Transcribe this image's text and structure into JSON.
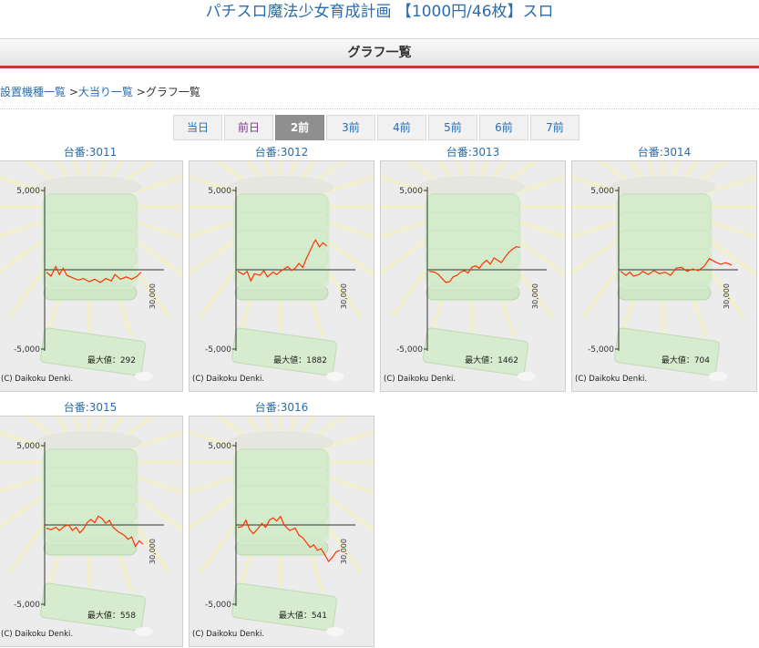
{
  "page": {
    "title": "パチスロ魔法少女育成計画 【1000円/46枚】スロ",
    "section_title": "グラフ一覧"
  },
  "breadcrumb": {
    "items": [
      "設置機種一覧",
      "大当り一覧"
    ],
    "current": "グラフ一覧",
    "separator": ">"
  },
  "day_tabs": [
    {
      "label": "当日",
      "active": false,
      "visited": false
    },
    {
      "label": "前日",
      "active": false,
      "visited": true
    },
    {
      "label": "2前",
      "active": true,
      "visited": false
    },
    {
      "label": "3前",
      "active": false,
      "visited": false
    },
    {
      "label": "4前",
      "active": false,
      "visited": false
    },
    {
      "label": "5前",
      "active": false,
      "visited": false
    },
    {
      "label": "6前",
      "active": false,
      "visited": false
    },
    {
      "label": "7前",
      "active": false,
      "visited": false
    }
  ],
  "graph_common": {
    "y_top_label": "5,000",
    "y_bottom_label": "-5,000",
    "x_max_label": "30,000",
    "max_label_prefix": "最大値：",
    "copyright": "(C) Daikoku Denki.",
    "y_range": [
      -5000,
      5000
    ],
    "x_range": [
      0,
      30000
    ],
    "line_color": "#ff3300",
    "axis_color": "#333333"
  },
  "machines": [
    {
      "label": "台番:3011",
      "max_value": "292",
      "points": [
        [
          0,
          -150
        ],
        [
          1200,
          -400
        ],
        [
          2500,
          200
        ],
        [
          3500,
          -300
        ],
        [
          4500,
          100
        ],
        [
          5500,
          -350
        ],
        [
          7000,
          -500
        ],
        [
          8500,
          -650
        ],
        [
          10000,
          -550
        ],
        [
          11500,
          -750
        ],
        [
          13000,
          -600
        ],
        [
          14500,
          -800
        ],
        [
          16000,
          -550
        ],
        [
          17500,
          -700
        ],
        [
          18500,
          -300
        ],
        [
          20000,
          -600
        ],
        [
          21500,
          -450
        ],
        [
          23000,
          -600
        ],
        [
          24500,
          -400
        ],
        [
          25500,
          -150
        ]
      ]
    },
    {
      "label": "台番:3012",
      "max_value": "1882",
      "points": [
        [
          0,
          -100
        ],
        [
          1500,
          -300
        ],
        [
          2500,
          -100
        ],
        [
          3500,
          -700
        ],
        [
          4500,
          -250
        ],
        [
          6000,
          -350
        ],
        [
          7000,
          -50
        ],
        [
          8000,
          -450
        ],
        [
          9500,
          -150
        ],
        [
          10500,
          -300
        ],
        [
          11500,
          -100
        ],
        [
          12500,
          50
        ],
        [
          13500,
          200
        ],
        [
          14500,
          -50
        ],
        [
          15500,
          100
        ],
        [
          16500,
          400
        ],
        [
          17500,
          150
        ],
        [
          18500,
          700
        ],
        [
          19500,
          1200
        ],
        [
          20500,
          1700
        ],
        [
          21000,
          1882
        ],
        [
          22000,
          1450
        ],
        [
          23000,
          1700
        ],
        [
          24000,
          1500
        ]
      ]
    },
    {
      "label": "台番:3013",
      "max_value": "1462",
      "points": [
        [
          0,
          -100
        ],
        [
          1500,
          -150
        ],
        [
          2500,
          -300
        ],
        [
          3500,
          -550
        ],
        [
          4500,
          -800
        ],
        [
          5500,
          -750
        ],
        [
          6500,
          -450
        ],
        [
          7500,
          -350
        ],
        [
          8500,
          -150
        ],
        [
          9500,
          -50
        ],
        [
          10500,
          -200
        ],
        [
          11500,
          150
        ],
        [
          12500,
          250
        ],
        [
          13500,
          100
        ],
        [
          14500,
          400
        ],
        [
          15500,
          600
        ],
        [
          16500,
          350
        ],
        [
          17500,
          750
        ],
        [
          18500,
          600
        ],
        [
          19500,
          450
        ],
        [
          20500,
          800
        ],
        [
          21500,
          1100
        ],
        [
          22500,
          1300
        ],
        [
          23500,
          1462
        ],
        [
          24500,
          1400
        ]
      ]
    },
    {
      "label": "台番:3014",
      "max_value": "704",
      "points": [
        [
          0,
          -100
        ],
        [
          1500,
          -350
        ],
        [
          2500,
          -150
        ],
        [
          3500,
          -400
        ],
        [
          5000,
          -300
        ],
        [
          6000,
          -100
        ],
        [
          7500,
          -300
        ],
        [
          9000,
          -50
        ],
        [
          10500,
          -250
        ],
        [
          12000,
          -150
        ],
        [
          13500,
          -350
        ],
        [
          15000,
          100
        ],
        [
          16500,
          150
        ],
        [
          18000,
          -100
        ],
        [
          19500,
          50
        ],
        [
          21000,
          -50
        ],
        [
          22500,
          200
        ],
        [
          24000,
          704
        ],
        [
          25500,
          500
        ],
        [
          27000,
          350
        ],
        [
          28500,
          450
        ],
        [
          30000,
          300
        ]
      ]
    },
    {
      "label": "台番:3015",
      "max_value": "558",
      "points": [
        [
          0,
          -200
        ],
        [
          1200,
          -300
        ],
        [
          2500,
          -150
        ],
        [
          3500,
          -350
        ],
        [
          5000,
          -50
        ],
        [
          6000,
          0
        ],
        [
          7000,
          -350
        ],
        [
          8000,
          -150
        ],
        [
          9000,
          -500
        ],
        [
          10000,
          -250
        ],
        [
          11000,
          150
        ],
        [
          12000,
          350
        ],
        [
          13000,
          150
        ],
        [
          14000,
          558
        ],
        [
          15000,
          400
        ],
        [
          16000,
          100
        ],
        [
          17000,
          300
        ],
        [
          18000,
          -150
        ],
        [
          19500,
          -450
        ],
        [
          21000,
          -650
        ],
        [
          22000,
          -900
        ],
        [
          23000,
          -750
        ],
        [
          24000,
          -1350
        ],
        [
          25000,
          -1000
        ],
        [
          26000,
          -1200
        ]
      ]
    },
    {
      "label": "台番:3016",
      "max_value": "541",
      "points": [
        [
          0,
          -150
        ],
        [
          1200,
          -100
        ],
        [
          2200,
          300
        ],
        [
          3200,
          -300
        ],
        [
          4200,
          -550
        ],
        [
          5500,
          -200
        ],
        [
          6500,
          100
        ],
        [
          7500,
          -150
        ],
        [
          8500,
          300
        ],
        [
          9500,
          450
        ],
        [
          10500,
          250
        ],
        [
          11500,
          541
        ],
        [
          12500,
          0
        ],
        [
          14000,
          -350
        ],
        [
          15500,
          -200
        ],
        [
          16500,
          -650
        ],
        [
          17500,
          -800
        ],
        [
          18500,
          -1100
        ],
        [
          19500,
          -1400
        ],
        [
          20500,
          -1250
        ],
        [
          21500,
          -1600
        ],
        [
          22500,
          -1500
        ],
        [
          23500,
          -1900
        ],
        [
          24500,
          -2300
        ],
        [
          25500,
          -2050
        ],
        [
          26500,
          -1700
        ],
        [
          27500,
          -1600
        ]
      ]
    }
  ]
}
